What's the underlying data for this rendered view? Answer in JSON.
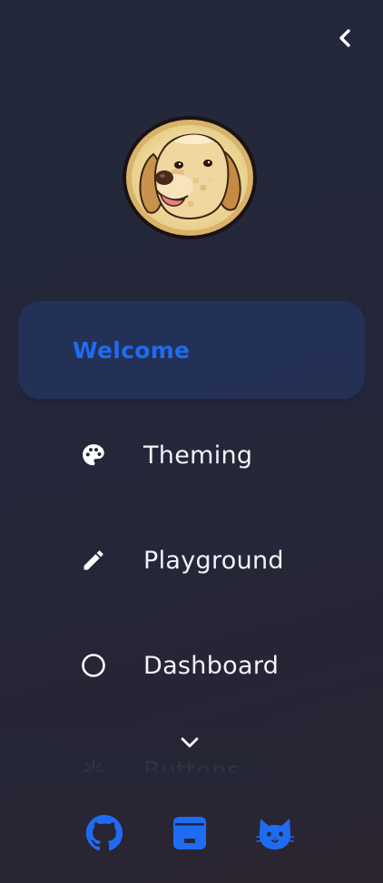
{
  "sidebar": {
    "collapse_icon": "chevron-left-icon",
    "avatar_subject": "pixel-art golden retriever dog",
    "nav": {
      "items": [
        {
          "label": "Welcome",
          "icon": "none",
          "active": true
        },
        {
          "label": "Theming",
          "icon": "palette-icon",
          "active": false
        },
        {
          "label": "Playground",
          "icon": "pencil-icon",
          "active": false
        },
        {
          "label": "Dashboard",
          "icon": "circle-icon",
          "active": false
        },
        {
          "label": "Buttons",
          "icon": "sparkle-icon",
          "active": false
        }
      ],
      "scroll_icon": "chevron-down-icon"
    },
    "footer": {
      "links": [
        {
          "name": "github-icon"
        },
        {
          "name": "storybook-icon"
        },
        {
          "name": "cat-icon"
        }
      ]
    }
  },
  "colors": {
    "accent": "#1f6bf2",
    "active_bg": "#243a6e",
    "text": "#f2f3f8",
    "background": "#24273a"
  }
}
